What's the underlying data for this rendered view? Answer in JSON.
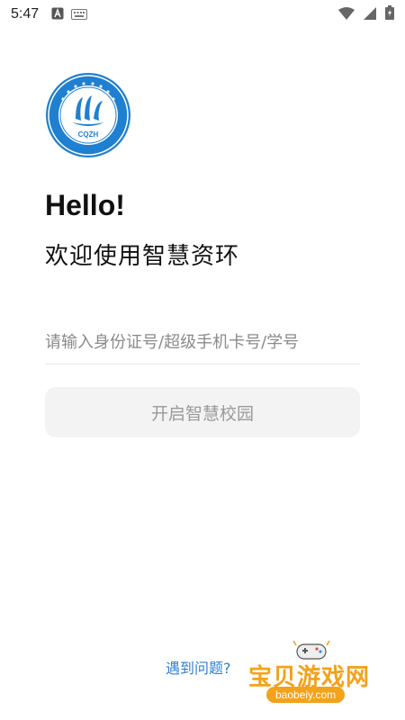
{
  "status_bar": {
    "time": "5:47",
    "left_icons": [
      "app-notification-icon",
      "keyboard-icon"
    ],
    "right_icons": [
      "wifi-icon",
      "cellular-signal-icon",
      "battery-icon"
    ]
  },
  "logo": {
    "text": "CQZH"
  },
  "greeting": {
    "title": "Hello!",
    "subtitle": "欢迎使用智慧资环"
  },
  "login": {
    "input_placeholder": "请输入身份证号/超级手机卡号/学号",
    "input_value": "",
    "button_label": "开启智慧校园"
  },
  "footer": {
    "help_link": "遇到问题?"
  },
  "watermark": {
    "title": "宝贝游戏网",
    "url": "baobeiy.com"
  },
  "colors": {
    "logo_blue": "#1f7fd0",
    "help_link": "#2f7fd6",
    "button_bg": "#f3f3f3",
    "watermark_orange": "#f3a21b"
  }
}
